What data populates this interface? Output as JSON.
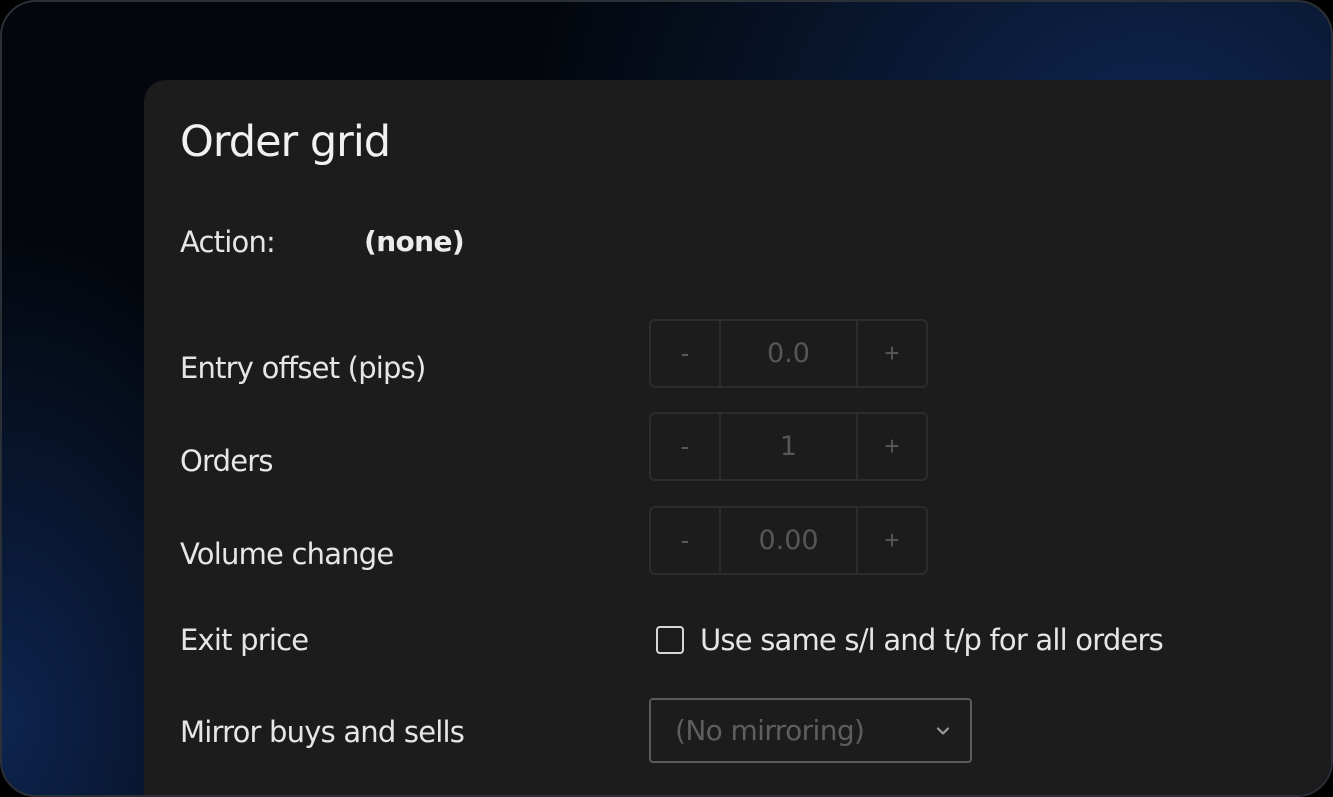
{
  "panel": {
    "title": "Order grid",
    "action": {
      "label": "Action:",
      "value": "(none)"
    },
    "entry_offset": {
      "label": "Entry offset (pips)",
      "minus": "-",
      "value": "0.0",
      "plus": "+"
    },
    "orders": {
      "label": "Orders",
      "minus": "-",
      "value": "1",
      "plus": "+"
    },
    "volume_change": {
      "label": "Volume change",
      "minus": "-",
      "value": "0.00",
      "plus": "+"
    },
    "exit_price": {
      "label": "Exit price",
      "checkbox_label": "Use same s/l and t/p for all orders",
      "checked": false
    },
    "mirror": {
      "label": "Mirror buys and sells",
      "selected": "(No mirroring)",
      "chevron_icon": "chevron-down-icon"
    }
  }
}
